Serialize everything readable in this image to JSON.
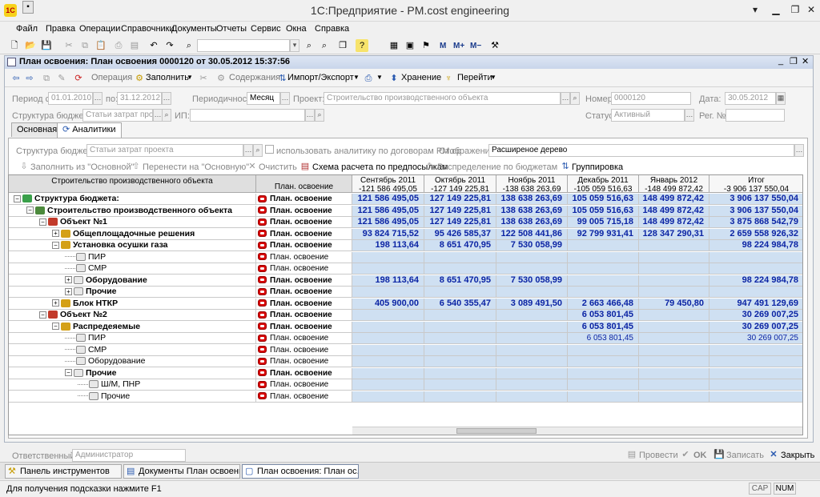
{
  "window": {
    "title": "1С:Предприятие - PM.cost engineering",
    "logo": "1С"
  },
  "menu": [
    "Файл",
    "Правка",
    "Операции",
    "Справочники",
    "Документы",
    "Отчеты",
    "Сервис",
    "Окна",
    "Справка"
  ],
  "toolbar": {
    "m_buttons": [
      "M",
      "M+",
      "M−"
    ]
  },
  "doc": {
    "title": "План освоения: План освоения 0000120 от 30.05.2012 15:37:56",
    "buttons": {
      "operation": "Операция",
      "fill": "Заполнить",
      "contents": "Содержания",
      "import_export": "Импорт/Экспорт",
      "storage": "Хранение",
      "goto": "Перейти"
    }
  },
  "header": {
    "period_from_label": "Период с:",
    "period_from": "01.01.2010",
    "period_to_label": "по:",
    "period_to": "31.12.2012",
    "periodicity_label": "Периодичность:",
    "periodicity": "Месяц",
    "project_label": "Проект:",
    "project": "Строительство производственного объекта",
    "number_label": "Номер:",
    "number": "0000120",
    "date_label": "Дата:",
    "date": "30.05.2012",
    "budget_structure_label": "Структура бюджета:",
    "budget_structure": "Статьи затрат про",
    "ip_label": "ИП:",
    "ip": "",
    "status_label": "Статус:",
    "status": "Активный",
    "reg_label": "Рег. №:",
    "reg": ""
  },
  "tabs": [
    "Основная",
    "Аналитики"
  ],
  "analytics": {
    "budget_structure_label": "Структура бюджета:",
    "budget_structure": "Статьи затрат проекта",
    "use_analytics": "использовать аналитику по договорам PM.cp",
    "display_label": "Отображение:",
    "display": "Расширеное дерево",
    "buttons": [
      "Заполнить из \"Основной\"",
      "Перенести на \"Основную\"",
      "Очистить",
      "Схема расчета по предпосылкам",
      "Распределение по бюджетам",
      "Группировка"
    ]
  },
  "grid": {
    "col_header_tree": "Строительство производственного объекта",
    "col_header_indicator": "План. освоение",
    "months": [
      {
        "name": "Сентябрь 2011",
        "total": "-121 586 495,05"
      },
      {
        "name": "Октябрь 2011",
        "total": "-127 149 225,81"
      },
      {
        "name": "Ноябрь 2011",
        "total": "-138 638 263,69"
      },
      {
        "name": "Декабрь 2011",
        "total": "-105 059 516,63"
      },
      {
        "name": "Январь 2012",
        "total": "-148 499 872,42"
      },
      {
        "name": "Итог",
        "total": "-3 906 137 550,04"
      }
    ],
    "rows": [
      {
        "label": "Структура бюджета:",
        "level": 0,
        "bold": true,
        "exp": "−",
        "icon": "budget-icon",
        "ind": "План. освоение",
        "vals": [
          "121 586 495,05",
          "127 149 225,81",
          "138 638 263,69",
          "105 059 516,63",
          "148 499 872,42",
          "3 906 137 550,04"
        ]
      },
      {
        "label": "Строительство производственного объекта",
        "level": 1,
        "bold": true,
        "exp": "−",
        "icon": "project-icon",
        "ind": "План. освоение",
        "vals": [
          "121 586 495,05",
          "127 149 225,81",
          "138 638 263,69",
          "105 059 516,63",
          "148 499 872,42",
          "3 906 137 550,04"
        ]
      },
      {
        "label": "Объект №1",
        "level": 2,
        "bold": true,
        "exp": "−",
        "icon": "object-icon",
        "ind": "План. освоение",
        "vals": [
          "121 586 495,05",
          "127 149 225,81",
          "138 638 263,69",
          "99 005 715,18",
          "148 499 872,42",
          "3 875 868 542,79"
        ]
      },
      {
        "label": "Общеплощадочные решения",
        "level": 3,
        "bold": true,
        "exp": "+",
        "icon": "folder-icon",
        "ind": "План. освоение",
        "vals": [
          "93 824 715,52",
          "95 426 585,37",
          "122 508 441,86",
          "92 799 931,41",
          "128 347 290,31",
          "2 659 558 926,32"
        ]
      },
      {
        "label": "Установка осушки газа",
        "level": 3,
        "bold": true,
        "exp": "−",
        "icon": "folder-icon",
        "ind": "План. освоение",
        "vals": [
          "198 113,64",
          "8 651 470,95",
          "7 530 058,99",
          "",
          "",
          "98 224 984,78"
        ]
      },
      {
        "label": "ПИР",
        "level": 4,
        "bold": false,
        "exp": "",
        "icon": "item-icon",
        "ind": "План. освоение",
        "vals": [
          "",
          "",
          "",
          "",
          "",
          ""
        ]
      },
      {
        "label": "СМР",
        "level": 4,
        "bold": false,
        "exp": "",
        "icon": "item-icon",
        "ind": "План. освоение",
        "vals": [
          "",
          "",
          "",
          "",
          "",
          ""
        ]
      },
      {
        "label": "Оборудование",
        "level": 4,
        "bold": true,
        "exp": "+",
        "icon": "item-icon",
        "ind": "План. освоение",
        "vals": [
          "198 113,64",
          "8 651 470,95",
          "7 530 058,99",
          "",
          "",
          "98 224 984,78"
        ]
      },
      {
        "label": "Прочие",
        "level": 4,
        "bold": true,
        "exp": "+",
        "icon": "item-icon",
        "ind": "План. освоение",
        "vals": [
          "",
          "",
          "",
          "",
          "",
          ""
        ]
      },
      {
        "label": "Блок НТКР",
        "level": 3,
        "bold": true,
        "exp": "+",
        "icon": "folder-icon",
        "ind": "План. освоение",
        "vals": [
          "405 900,00",
          "6 540 355,47",
          "3 089 491,50",
          "2 663 466,48",
          "79 450,80",
          "947 491 129,69"
        ]
      },
      {
        "label": "Объект №2",
        "level": 2,
        "bold": true,
        "exp": "−",
        "icon": "object-icon",
        "ind": "План. освоение",
        "vals": [
          "",
          "",
          "",
          "6 053 801,45",
          "",
          "30 269 007,25"
        ]
      },
      {
        "label": "Распредеяемые",
        "level": 3,
        "bold": true,
        "exp": "−",
        "icon": "folder-icon",
        "ind": "План. освоение",
        "vals": [
          "",
          "",
          "",
          "6 053 801,45",
          "",
          "30 269 007,25"
        ]
      },
      {
        "label": "ПИР",
        "level": 4,
        "bold": false,
        "exp": "",
        "icon": "item-icon",
        "ind": "План. освоение",
        "plain": true,
        "vals": [
          "",
          "",
          "",
          "6 053 801,45",
          "",
          "30 269 007,25"
        ]
      },
      {
        "label": "СМР",
        "level": 4,
        "bold": false,
        "exp": "",
        "icon": "item-icon",
        "ind": "План. освоение",
        "vals": [
          "",
          "",
          "",
          "",
          "",
          ""
        ]
      },
      {
        "label": "Оборудование",
        "level": 4,
        "bold": false,
        "exp": "",
        "icon": "item-icon",
        "ind": "План. освоение",
        "vals": [
          "",
          "",
          "",
          "",
          "",
          ""
        ]
      },
      {
        "label": "Прочие",
        "level": 4,
        "bold": true,
        "exp": "−",
        "icon": "item-icon",
        "ind": "План. освоение",
        "vals": [
          "",
          "",
          "",
          "",
          "",
          ""
        ]
      },
      {
        "label": "Ш/М, ПНР",
        "level": 5,
        "bold": false,
        "exp": "",
        "icon": "item-icon",
        "ind": "План. освоение",
        "vals": [
          "",
          "",
          "",
          "",
          "",
          ""
        ]
      },
      {
        "label": "Прочие",
        "level": 5,
        "bold": false,
        "exp": "",
        "icon": "item-icon",
        "ind": "План. освоение",
        "vals": [
          "",
          "",
          "",
          "",
          "",
          ""
        ]
      }
    ]
  },
  "footer": {
    "responsible_label": "Ответственный:",
    "responsible": "Администратор",
    "buttons": {
      "post": "Провести",
      "ok": "OK",
      "save": "Записать",
      "close": "Закрыть"
    }
  },
  "taskbar": [
    "Панель инструментов",
    "Документы План освоения...",
    "План освоения: План ос...:56"
  ],
  "status": {
    "hint": "Для получения подсказки нажмите F1",
    "caps": "CAP",
    "num": "NUM"
  },
  "colors": {
    "number_blue": "#0b24a4",
    "cell_blue": "#cfe0f2",
    "indicator_red": "#d80000"
  }
}
